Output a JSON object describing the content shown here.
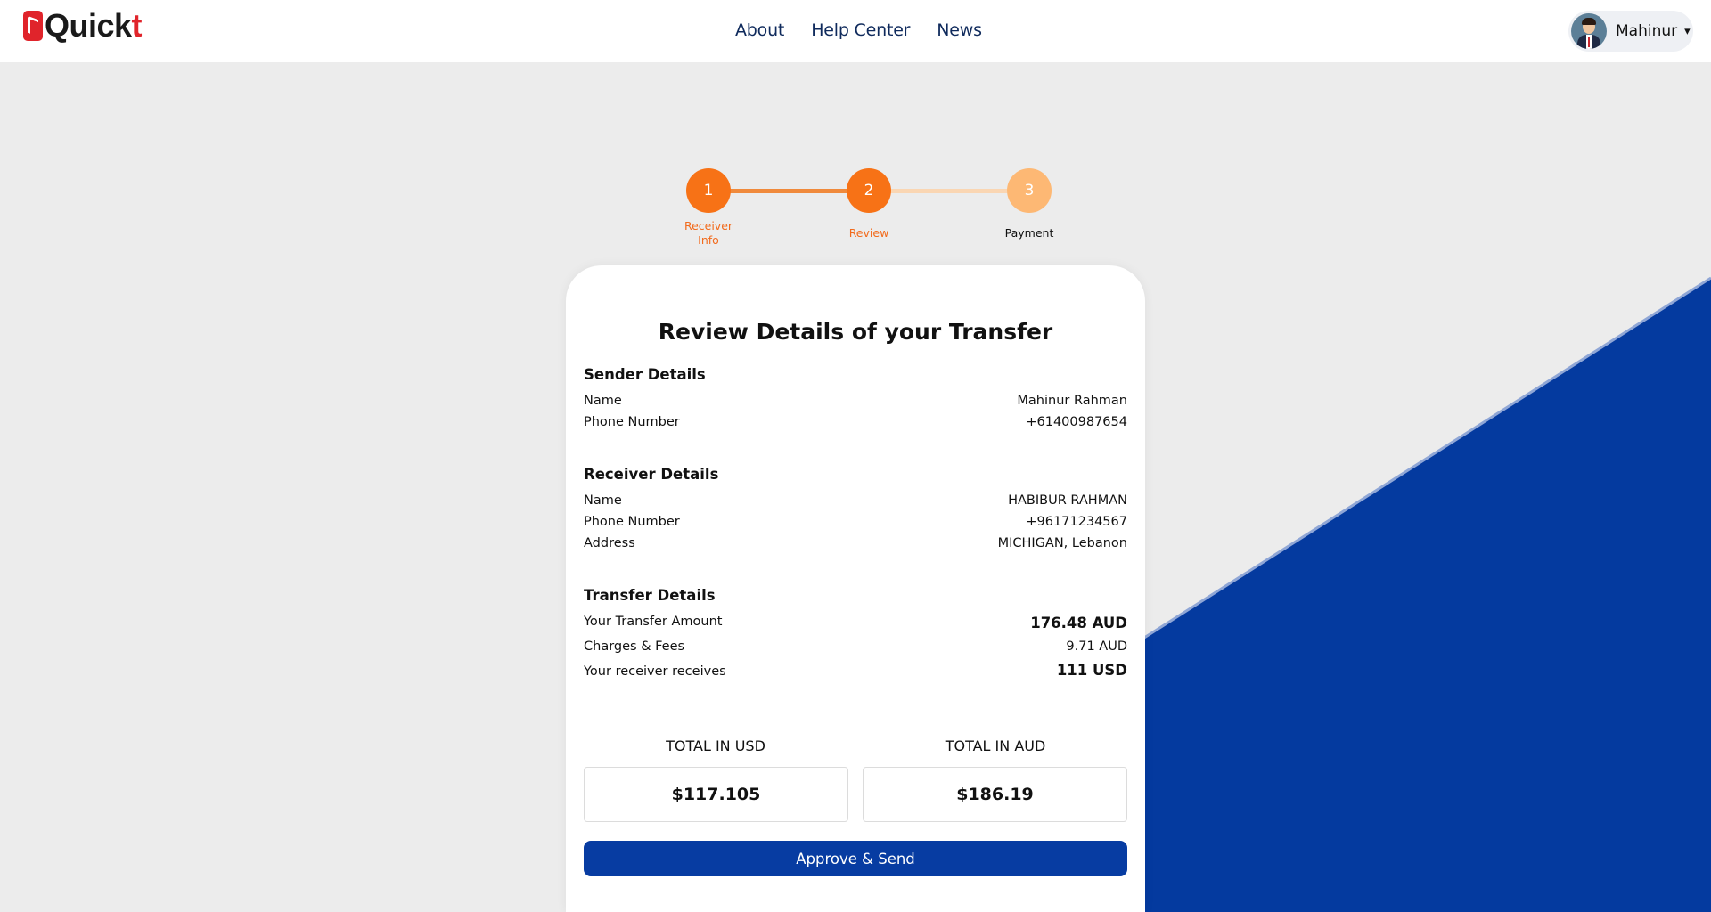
{
  "brand": {
    "name_main": "Quick",
    "name_accent": "t"
  },
  "nav": [
    {
      "label": "About"
    },
    {
      "label": "Help Center"
    },
    {
      "label": "News"
    }
  ],
  "user": {
    "name": "Mahinur",
    "caret": "▾"
  },
  "stepper": {
    "steps": [
      {
        "number": "1",
        "label_line1": "Receiver",
        "label_line2": "Info",
        "state": "done"
      },
      {
        "number": "2",
        "label": "Review",
        "state": "active"
      },
      {
        "number": "3",
        "label": "Payment",
        "state": "upcoming"
      }
    ]
  },
  "card": {
    "title": "Review Details of your Transfer",
    "sender": {
      "heading": "Sender Details",
      "rows": [
        {
          "label": "Name",
          "value": "Mahinur Rahman"
        },
        {
          "label": "Phone Number",
          "value": "+61400987654"
        }
      ]
    },
    "receiver": {
      "heading": "Receiver Details",
      "rows": [
        {
          "label": "Name",
          "value": "HABIBUR RAHMAN"
        },
        {
          "label": "Phone Number",
          "value": "+96171234567"
        },
        {
          "label": "Address",
          "value": "MICHIGAN, Lebanon"
        }
      ]
    },
    "transfer": {
      "heading": "Transfer Details",
      "rows": [
        {
          "label": "Your Transfer Amount",
          "value": "176.48 AUD"
        },
        {
          "label": "Charges & Fees",
          "value": "9.71 AUD"
        },
        {
          "label": "Your receiver receives",
          "value": "111 USD"
        }
      ]
    },
    "totals": {
      "usd_label": "TOTAL IN USD",
      "usd_value": "$117.105",
      "aud_label": "TOTAL IN AUD",
      "aud_value": "$186.19"
    },
    "approve_label": "Approve & Send"
  },
  "colors": {
    "accent_orange": "#f77216",
    "light_orange": "#fdb874",
    "primary_blue": "#073ca2",
    "brand_red": "#e0242b"
  }
}
